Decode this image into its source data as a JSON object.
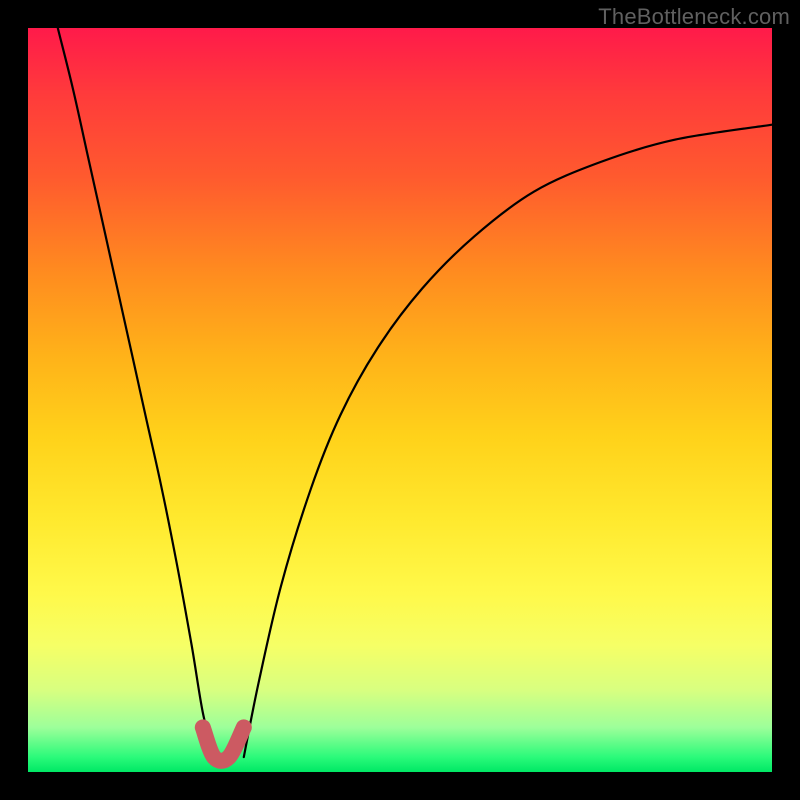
{
  "watermark": "TheBottleneck.com",
  "colors": {
    "frame": "#000000",
    "curve": "#000000",
    "bump": "#cc5a62",
    "gradient_stops": [
      "#ff1a4a",
      "#ff3b3b",
      "#ff5a2e",
      "#ff8c1f",
      "#ffb219",
      "#ffd21a",
      "#ffe92e",
      "#fff94a",
      "#f6ff66",
      "#d8ff80",
      "#9dff9a",
      "#2bfa7a",
      "#00e865"
    ]
  },
  "chart_data": {
    "type": "line",
    "title": "",
    "xlabel": "",
    "ylabel": "",
    "xlim": [
      0,
      100
    ],
    "ylim": [
      0,
      100
    ],
    "grid": false,
    "series": [
      {
        "name": "bottleneck-curve-left",
        "x": [
          4,
          6,
          8,
          10,
          12,
          14,
          16,
          18,
          20,
          22,
          23.5,
          25
        ],
        "y": [
          100,
          92,
          83,
          74,
          65,
          56,
          47,
          38,
          28,
          17,
          8,
          2
        ]
      },
      {
        "name": "bottleneck-curve-right",
        "x": [
          29,
          31,
          34,
          38,
          42,
          47,
          53,
          60,
          68,
          77,
          87,
          100
        ],
        "y": [
          2,
          12,
          25,
          38,
          48,
          57,
          65,
          72,
          78,
          82,
          85,
          87
        ]
      },
      {
        "name": "optimal-band",
        "x": [
          23.5,
          25,
          27,
          29
        ],
        "y": [
          6,
          2,
          2,
          6
        ]
      }
    ],
    "annotations": []
  }
}
